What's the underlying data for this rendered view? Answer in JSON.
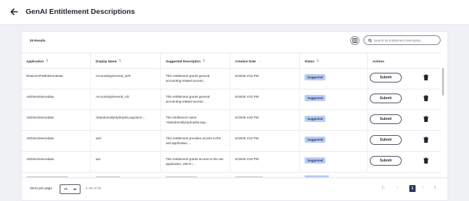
{
  "header": {
    "title": "GenAI Entitlement Descriptions"
  },
  "toolbar": {
    "results_count": "25 Results",
    "search_placeholder": "Search by Entitlement Description ..."
  },
  "table": {
    "columns": [
      {
        "label": "Application",
        "sort": "⇅"
      },
      {
        "label": "Display Name",
        "sort": "⇅"
      },
      {
        "label": "Suggested Description",
        "sort": "⇅"
      },
      {
        "label": "Creation Date",
        "sort": "⌄"
      },
      {
        "label": "Status",
        "sort": "⇅"
      },
      {
        "label": "Actions",
        "sort": ""
      }
    ],
    "rows": [
      {
        "application": "RealLDAPWithDemoData",
        "display_name": "AccountingGeneral_LDP",
        "description": "This entitlement grants general accounting-related access…",
        "date": "5/19/25 4:02 PM",
        "status": "Suggested",
        "action": "Submit"
      },
      {
        "application": "ADDirectDemodata",
        "display_name": "AccountingGeneral_AD",
        "description": "This entitlement grants general accounting-related access…",
        "date": "5/19/25 4:02 PM",
        "status": "Suggested",
        "action": "Submit"
      },
      {
        "application": "ADDirectDemodata",
        "display_name": "AbandonedlyHydropticLegumins-…",
        "description": "The entitlement name 'AbandonedlyHydropticLegu…",
        "date": "5/19/25 4:02 PM",
        "status": "Suggested",
        "action": "Submit"
      },
      {
        "application": "ADDirectDemodata",
        "display_name": "a2d",
        "description": "This entitlement provides access to the a2d application,…",
        "date": "5/19/25 4:02 PM",
        "status": "Suggested",
        "action": "Submit"
      },
      {
        "application": "ADDirectDemodata",
        "display_name": "a2c",
        "description": "This entitlement grants access to the a2c application, which i…",
        "date": "5/19/25 4:02 PM",
        "status": "Suggested",
        "action": "Submit"
      }
    ]
  },
  "footer": {
    "items_per_page_label": "Items per page",
    "items_per_page_value": "25",
    "range": "1–25 of 25",
    "current_page": "1"
  },
  "icons": {
    "back": "arrow-left-icon",
    "columns": "columns-icon",
    "search": "search-icon",
    "trash": "trash-icon",
    "first": "first-page-icon",
    "prev": "prev-page-icon",
    "next": "next-page-icon",
    "last": "last-page-icon"
  },
  "colors": {
    "badge_bg": "#b9cdf0",
    "accent": "#2b3a55"
  }
}
